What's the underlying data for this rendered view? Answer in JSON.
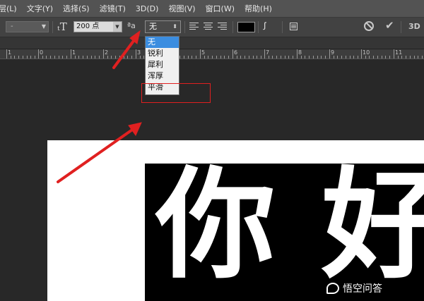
{
  "menubar": {
    "items": [
      "层(L)",
      "文字(Y)",
      "选择(S)",
      "滤镜(T)",
      "3D(D)",
      "视图(V)",
      "窗口(W)",
      "帮助(H)"
    ]
  },
  "options": {
    "font_style": "-",
    "size_value": "200 点",
    "aa_icon_text": "ªa",
    "aa_value": "无",
    "color_hex": "#000000",
    "threed_label": "3D"
  },
  "ruler": {
    "labels": [
      "2",
      "1",
      "0",
      "1",
      "2",
      "3",
      "4",
      "5",
      "6",
      "7",
      "8",
      "9",
      "10",
      "11",
      "12"
    ]
  },
  "dropdown": {
    "options": [
      "无",
      "锐利",
      "犀利",
      "浑厚",
      "平滑"
    ],
    "selected_index": 0,
    "highlighted_option": "平滑"
  },
  "canvas": {
    "text_char1": "你",
    "text_char2": "好"
  },
  "watermark": {
    "text": "悟空问答"
  },
  "colors": {
    "annotation": "#e02020",
    "selection": "#3b8de0"
  }
}
